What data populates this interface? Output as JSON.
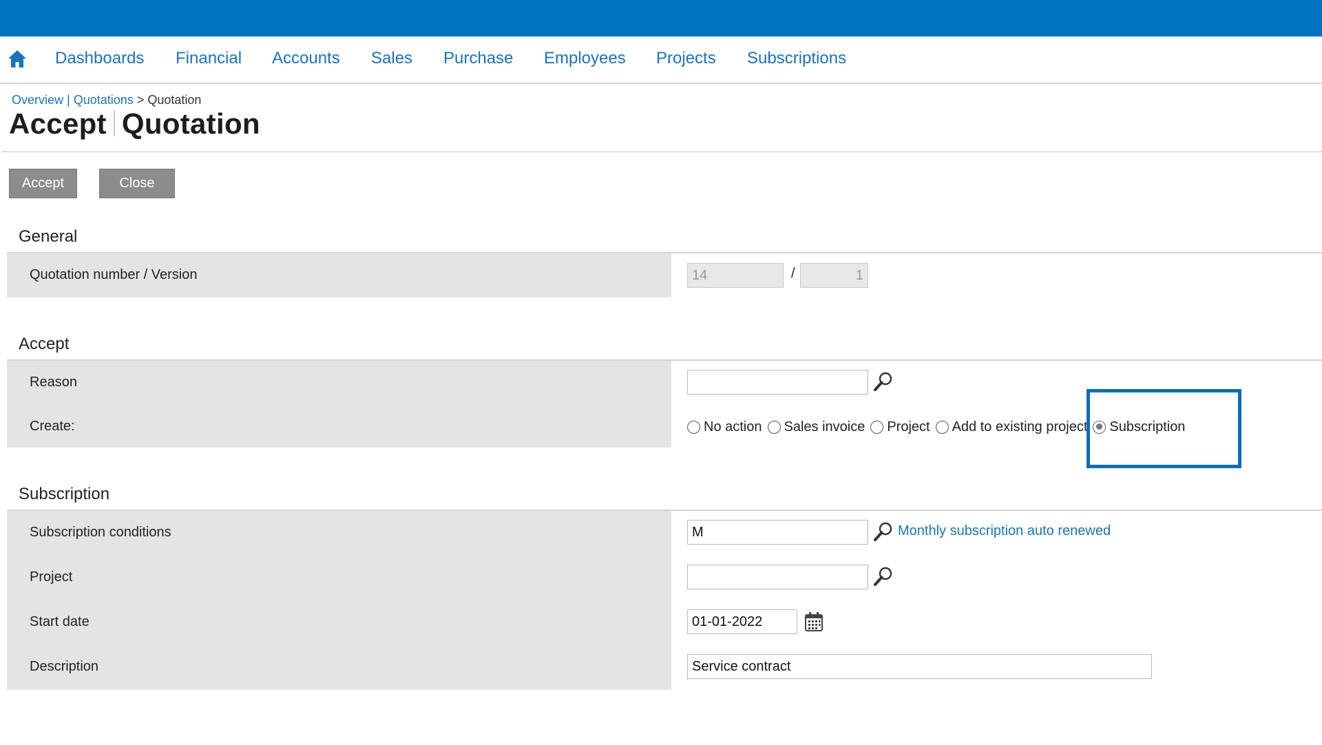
{
  "nav": {
    "home_icon": "home-icon",
    "items": [
      "Dashboards",
      "Financial",
      "Accounts",
      "Sales",
      "Purchase",
      "Employees",
      "Projects",
      "Subscriptions"
    ]
  },
  "breadcrumb": {
    "overview": "Overview",
    "separator": "|",
    "quotations": "Quotations",
    "arrow": ">",
    "current": "Quotation"
  },
  "page": {
    "title_action": "Accept",
    "title_entity": "Quotation"
  },
  "toolbar": {
    "accept_label": "Accept",
    "close_label": "Close"
  },
  "general": {
    "section_title": "General",
    "quotation_label": "Quotation number / Version",
    "quotation_number": "14",
    "version_separator": "/",
    "version": "1"
  },
  "accept": {
    "section_title": "Accept",
    "reason_label": "Reason",
    "reason_value": "",
    "create_label": "Create:",
    "create_options": [
      "No action",
      "Sales invoice",
      "Project",
      "Add to existing project",
      "Subscription"
    ],
    "create_selected": "Subscription"
  },
  "subscription": {
    "section_title": "Subscription",
    "conditions_label": "Subscription conditions",
    "conditions_value": "M",
    "conditions_description": "Monthly subscription auto renewed",
    "project_label": "Project",
    "project_value": "",
    "start_date_label": "Start date",
    "start_date_value": "01-01-2022",
    "description_label": "Description",
    "description_value": "Service contract"
  },
  "colors": {
    "brand_blue": "#0074bf",
    "link_blue": "#1a73bb",
    "button_gray": "#8c8c8c",
    "panel_gray": "#e4e4e4",
    "highlight": "#0b6db9"
  }
}
